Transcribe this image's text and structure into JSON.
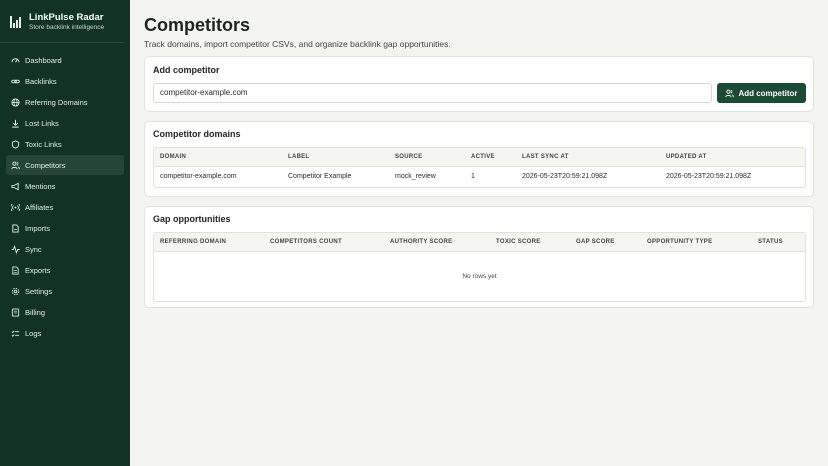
{
  "app": {
    "title": "LinkPulse Radar",
    "subtitle": "Store backlink intelligence"
  },
  "sidebar": {
    "items": [
      {
        "label": "Dashboard",
        "icon": "dashboard-icon"
      },
      {
        "label": "Backlinks",
        "icon": "link-icon"
      },
      {
        "label": "Referring Domains",
        "icon": "globe-icon"
      },
      {
        "label": "Lost Links",
        "icon": "arrow-down-icon"
      },
      {
        "label": "Toxic Links",
        "icon": "shield-icon"
      },
      {
        "label": "Competitors",
        "icon": "users-icon",
        "active": true
      },
      {
        "label": "Mentions",
        "icon": "megaphone-icon"
      },
      {
        "label": "Affiliates",
        "icon": "radio-icon"
      },
      {
        "label": "Imports",
        "icon": "import-icon"
      },
      {
        "label": "Sync",
        "icon": "activity-icon"
      },
      {
        "label": "Exports",
        "icon": "file-icon"
      },
      {
        "label": "Settings",
        "icon": "gear-icon"
      },
      {
        "label": "Billing",
        "icon": "billing-icon"
      },
      {
        "label": "Logs",
        "icon": "list-icon"
      }
    ]
  },
  "header": {
    "title": "Competitors",
    "subtitle": "Track domains, import competitor CSVs, and organize backlink gap opportunities."
  },
  "add_competitor": {
    "title": "Add competitor",
    "input_value": "competitor-example.com",
    "button_label": "Add competitor"
  },
  "competitor_domains": {
    "title": "Competitor domains",
    "columns": [
      "DOMAIN",
      "LABEL",
      "SOURCE",
      "ACTIVE",
      "LAST SYNC AT",
      "UPDATED AT"
    ],
    "rows": [
      [
        "competitor-example.com",
        "Competitor Example",
        "mock_review",
        "1",
        "2026-05-23T20:59:21.098Z",
        "2026-05-23T20:59:21.098Z"
      ]
    ]
  },
  "gap_opportunities": {
    "title": "Gap opportunities",
    "columns": [
      "REFERRING DOMAIN",
      "COMPETITORS COUNT",
      "AUTHORITY SCORE",
      "TOXIC SCORE",
      "GAP SCORE",
      "OPPORTUNITY TYPE",
      "STATUS"
    ],
    "empty_text": "No rows yet"
  },
  "colors": {
    "sidebar_bg": "#123225",
    "accent": "#1b4a35",
    "page_bg": "#f4f4f1"
  }
}
